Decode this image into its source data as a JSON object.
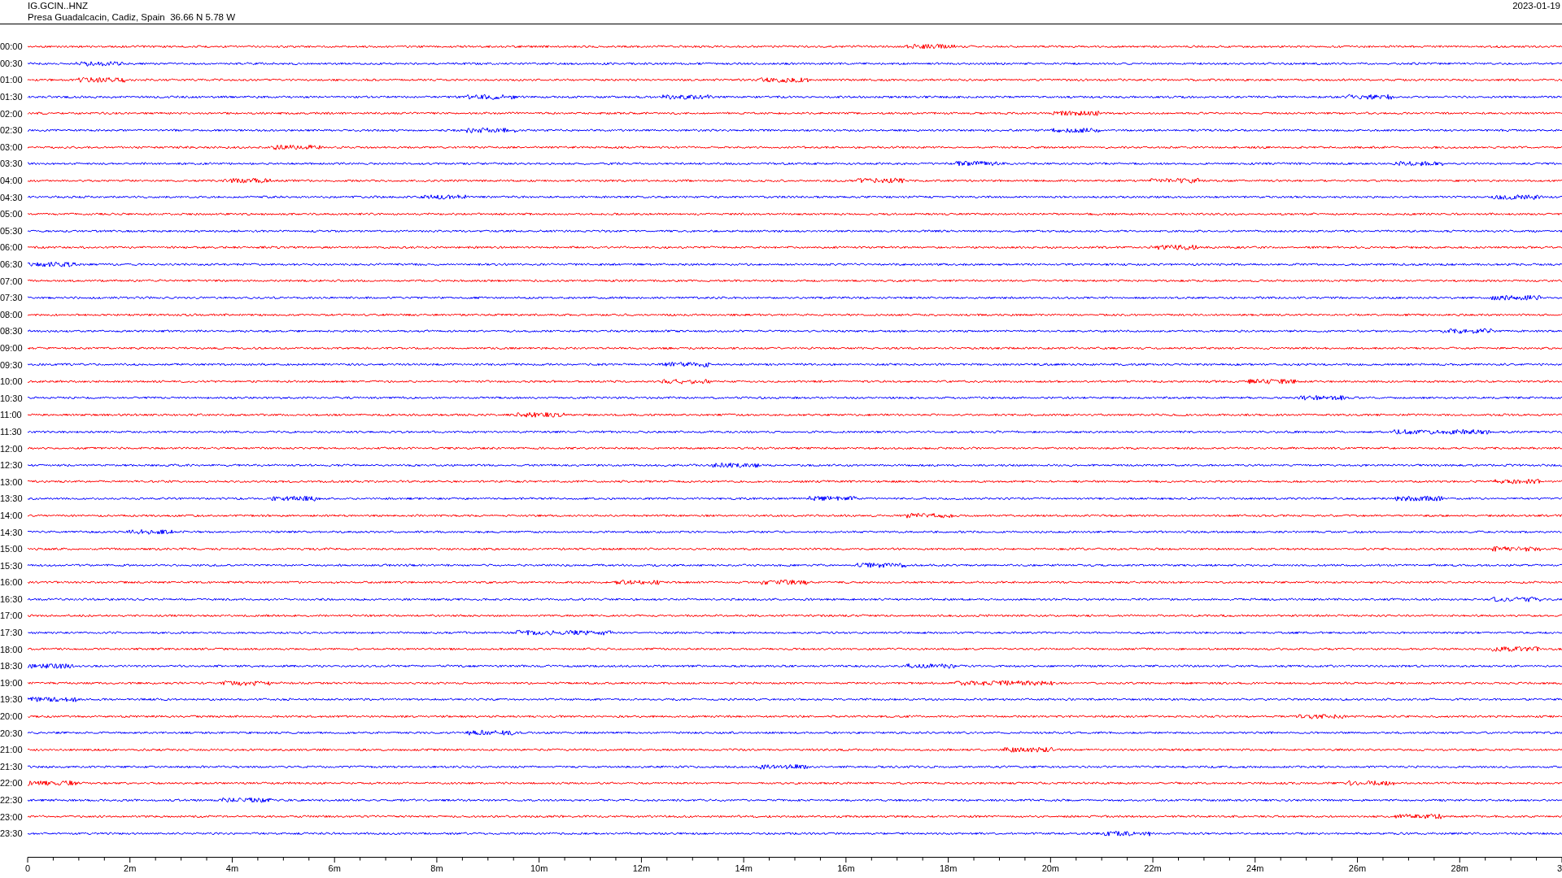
{
  "header": {
    "station": "IG.GCIN..HNZ",
    "location": "Presa Guadalcacin, Cadiz, Spain  36.66 N 5.78 W",
    "date": "2023-01-19"
  },
  "traces": [
    {
      "label": "00:00",
      "color": "#ff0000"
    },
    {
      "label": "00:30",
      "color": "#0000ff"
    },
    {
      "label": "01:00",
      "color": "#ff0000"
    },
    {
      "label": "01:30",
      "color": "#0000ff"
    },
    {
      "label": "02:00",
      "color": "#ff0000"
    },
    {
      "label": "02:30",
      "color": "#0000ff"
    },
    {
      "label": "03:00",
      "color": "#ff0000"
    },
    {
      "label": "03:30",
      "color": "#0000ff"
    },
    {
      "label": "04:00",
      "color": "#ff0000"
    },
    {
      "label": "04:30",
      "color": "#0000ff"
    },
    {
      "label": "05:00",
      "color": "#ff0000"
    },
    {
      "label": "05:30",
      "color": "#0000ff"
    },
    {
      "label": "06:00",
      "color": "#ff0000"
    },
    {
      "label": "06:30",
      "color": "#0000ff"
    },
    {
      "label": "07:00",
      "color": "#ff0000"
    },
    {
      "label": "07:30",
      "color": "#0000ff"
    },
    {
      "label": "08:00",
      "color": "#ff0000"
    },
    {
      "label": "08:30",
      "color": "#0000ff"
    },
    {
      "label": "09:00",
      "color": "#ff0000"
    },
    {
      "label": "09:30",
      "color": "#0000ff"
    },
    {
      "label": "10:00",
      "color": "#ff0000"
    },
    {
      "label": "10:30",
      "color": "#0000ff"
    },
    {
      "label": "11:00",
      "color": "#ff0000"
    },
    {
      "label": "11:30",
      "color": "#0000ff"
    },
    {
      "label": "12:00",
      "color": "#ff0000"
    },
    {
      "label": "12:30",
      "color": "#0000ff"
    },
    {
      "label": "13:00",
      "color": "#ff0000"
    },
    {
      "label": "13:30",
      "color": "#0000ff"
    },
    {
      "label": "14:00",
      "color": "#ff0000"
    },
    {
      "label": "14:30",
      "color": "#0000ff"
    },
    {
      "label": "15:00",
      "color": "#ff0000"
    },
    {
      "label": "15:30",
      "color": "#0000ff"
    },
    {
      "label": "16:00",
      "color": "#ff0000"
    },
    {
      "label": "16:30",
      "color": "#0000ff"
    },
    {
      "label": "17:00",
      "color": "#ff0000"
    },
    {
      "label": "17:30",
      "color": "#0000ff"
    },
    {
      "label": "18:00",
      "color": "#ff0000"
    },
    {
      "label": "18:30",
      "color": "#0000ff"
    },
    {
      "label": "19:00",
      "color": "#ff0000"
    },
    {
      "label": "19:30",
      "color": "#0000ff"
    },
    {
      "label": "20:00",
      "color": "#ff0000"
    },
    {
      "label": "20:30",
      "color": "#0000ff"
    },
    {
      "label": "21:00",
      "color": "#ff0000"
    },
    {
      "label": "21:30",
      "color": "#0000ff"
    },
    {
      "label": "22:00",
      "color": "#ff0000"
    },
    {
      "label": "22:30",
      "color": "#0000ff"
    },
    {
      "label": "23:00",
      "color": "#ff0000"
    },
    {
      "label": "23:30",
      "color": "#0000ff"
    }
  ],
  "axis": {
    "labels": [
      "0",
      "2m",
      "4m",
      "6m",
      "8m",
      "10m",
      "12m",
      "14m",
      "16m",
      "18m",
      "20m",
      "22m",
      "24m",
      "26m",
      "28m",
      "3"
    ]
  }
}
